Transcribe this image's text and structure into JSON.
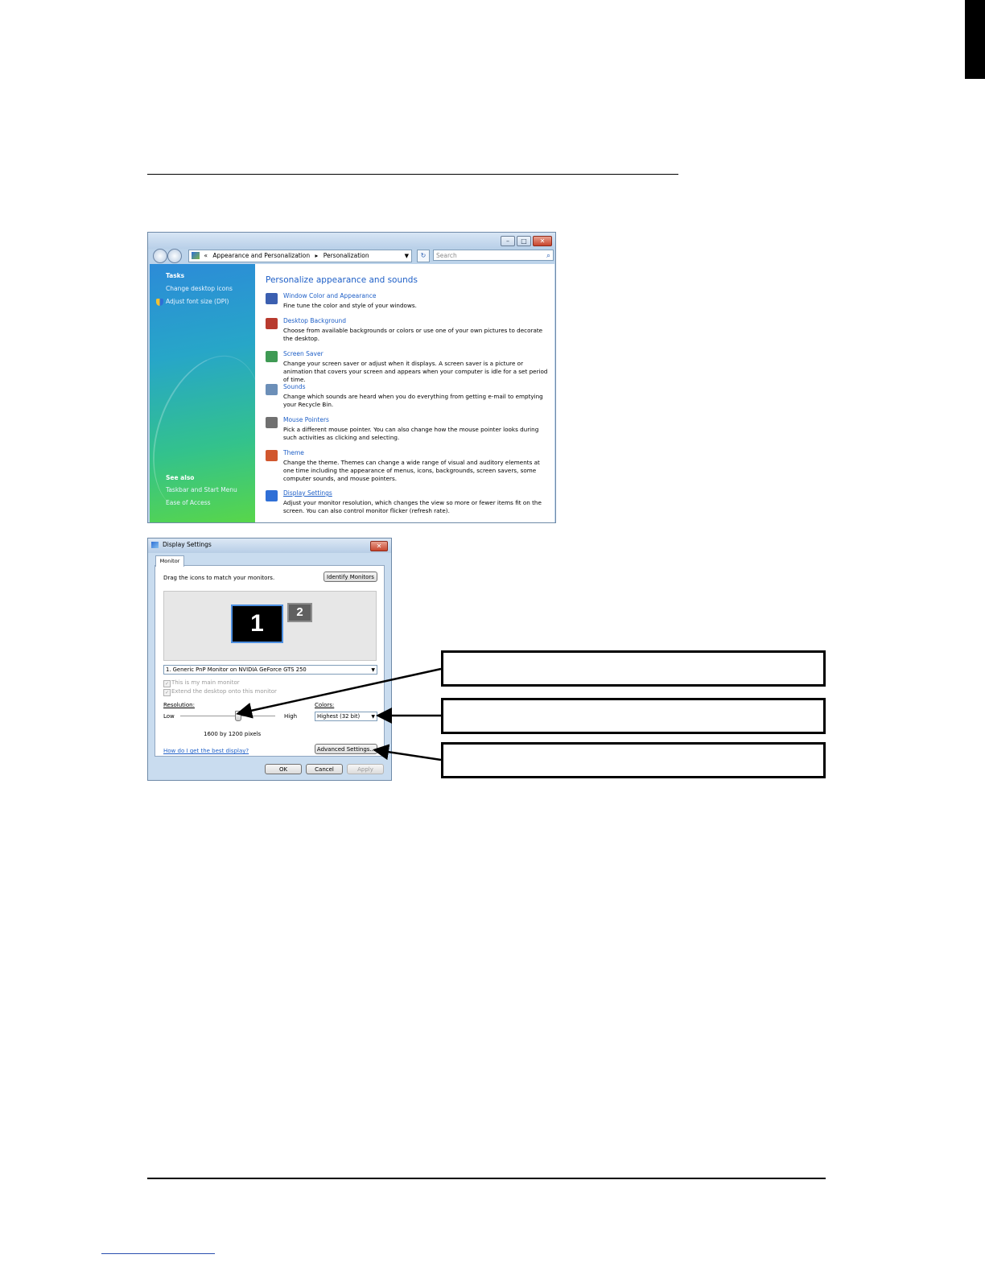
{
  "personalization_window": {
    "address": {
      "back": "«",
      "crumb1": "Appearance and Personalization",
      "sep": "▸",
      "crumb2": "Personalization"
    },
    "search_placeholder": "Search",
    "sidebar": {
      "tasks_heading": "Tasks",
      "tasks": [
        "Change desktop icons",
        "Adjust font size (DPI)"
      ],
      "see_also_heading": "See also",
      "see_also": [
        "Taskbar and Start Menu",
        "Ease of Access"
      ]
    },
    "heading": "Personalize appearance and sounds",
    "items": [
      {
        "title": "Window Color and Appearance",
        "desc": "Fine tune the color and style of your windows.",
        "icon": "window-color-icon",
        "color": "#3b5fb0"
      },
      {
        "title": "Desktop Background",
        "desc": "Choose from available backgrounds or colors or use one of your own pictures to decorate the desktop.",
        "icon": "desktop-background-icon",
        "color": "#b83a2e"
      },
      {
        "title": "Screen Saver",
        "desc": "Change your screen saver or adjust when it displays. A screen saver is a picture or animation that covers your screen and appears when your computer is idle for a set period of time.",
        "icon": "screen-saver-icon",
        "color": "#3f9a54"
      },
      {
        "title": "Sounds",
        "desc": "Change which sounds are heard when you do everything from getting e-mail to emptying your Recycle Bin.",
        "icon": "sounds-icon",
        "color": "#6c8fb8"
      },
      {
        "title": "Mouse Pointers",
        "desc": "Pick a different mouse pointer. You can also change how the mouse pointer looks during such activities as clicking and selecting.",
        "icon": "mouse-pointer-icon",
        "color": "#707070"
      },
      {
        "title": "Theme",
        "desc": "Change the theme. Themes can change a wide range of visual and auditory elements at one time including the appearance of menus, icons, backgrounds, screen savers, some computer sounds, and mouse pointers.",
        "icon": "theme-icon",
        "color": "#d1572e"
      },
      {
        "title": "Display Settings",
        "desc": "Adjust your monitor resolution, which changes the view so more or fewer items fit on the screen. You can also control monitor flicker (refresh rate).",
        "icon": "display-settings-icon",
        "color": "#2f6fd6"
      }
    ]
  },
  "display_dialog": {
    "title": "Display Settings",
    "tab": "Monitor",
    "drag_text": "Drag the icons to match your monitors.",
    "identify_button": "Identify Monitors",
    "monitor1": "1",
    "monitor2": "2",
    "monitor_select": "1. Generic PnP Monitor on NVIDIA GeForce GTS 250",
    "checkbox_main": "This is my main monitor",
    "checkbox_extend": "Extend the desktop onto this monitor",
    "resolution_label": "Resolution:",
    "low": "Low",
    "high": "High",
    "resolution_value": "1600 by 1200 pixels",
    "resolution_slider_fraction": 0.6,
    "colors_label": "Colors:",
    "colors_value": "Highest (32 bit)",
    "help_link": "How do I get the best display?",
    "advanced_button": "Advanced Settings...",
    "ok": "OK",
    "cancel": "Cancel",
    "apply": "Apply"
  }
}
